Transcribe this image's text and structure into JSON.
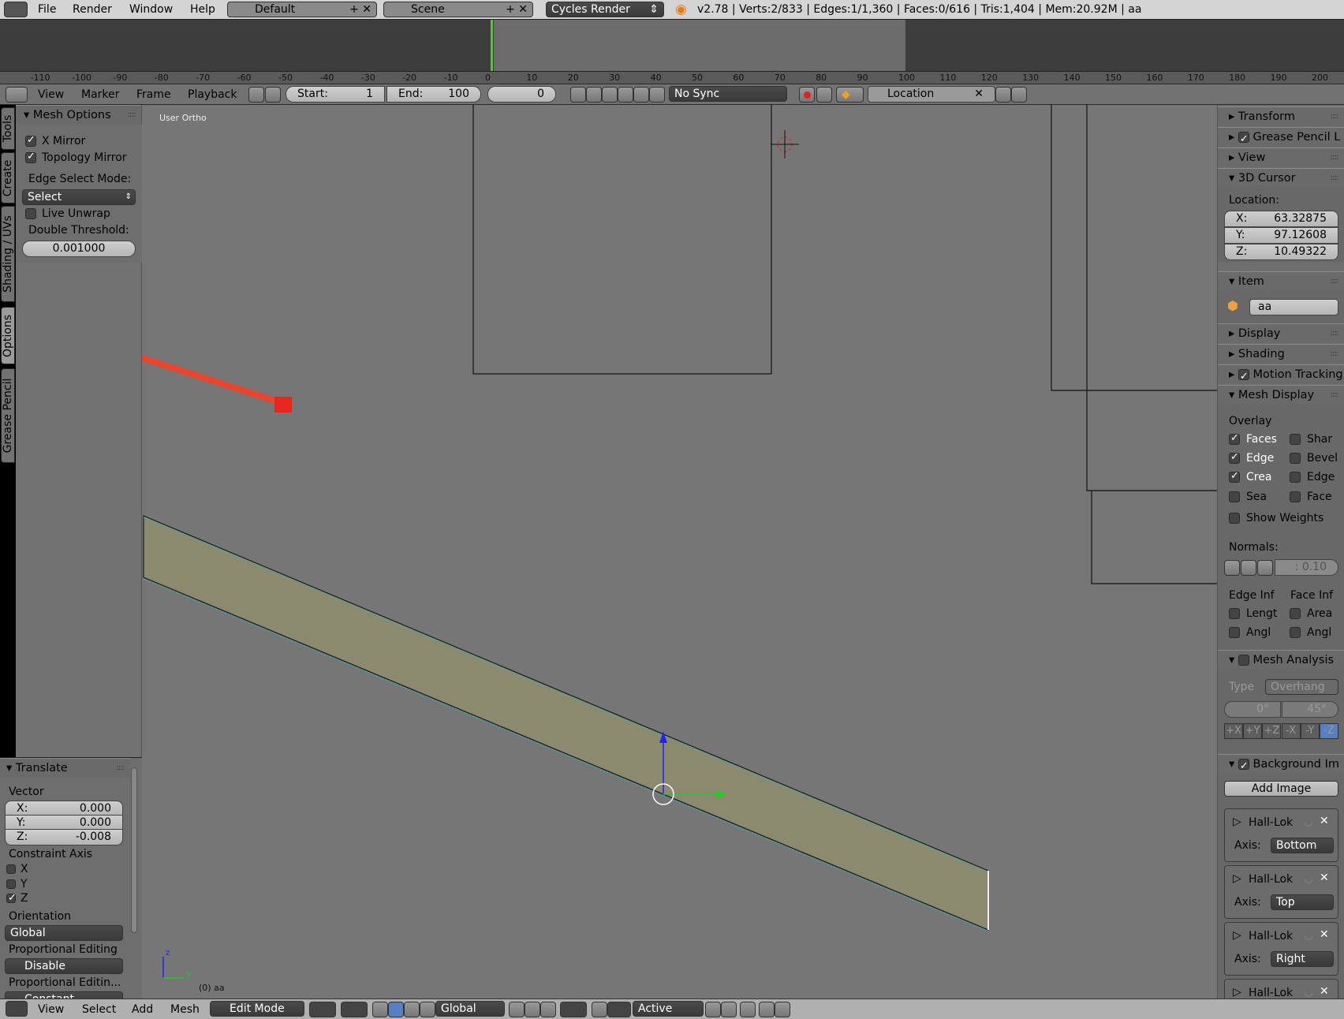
{
  "topbar": {
    "menus": [
      "File",
      "Render",
      "Window",
      "Help"
    ],
    "layout": "Default",
    "scene": "Scene",
    "engine": "Cycles Render",
    "stats": "v2.78 | Verts:2/833 | Edges:1/1,360 | Faces:0/616 | Tris:1,404 | Mem:20.92M | aa"
  },
  "timeline": {
    "ruler_ticks": [
      "-110",
      "-100",
      "-90",
      "-80",
      "-70",
      "-60",
      "-50",
      "-40",
      "-30",
      "-20",
      "-10",
      "0",
      "10",
      "20",
      "30",
      "40",
      "50",
      "60",
      "70",
      "80",
      "90",
      "100",
      "110",
      "120",
      "130",
      "140",
      "150",
      "160",
      "170",
      "180",
      "190",
      "200"
    ],
    "current_frame_marker": 0,
    "range_end": 100
  },
  "timeline_header": {
    "menus": [
      "View",
      "Marker",
      "Frame",
      "Playback"
    ],
    "start_label": "Start:",
    "start": "1",
    "end_label": "End:",
    "end": "100",
    "current": "0",
    "sync": "No Sync",
    "keying_set": "Location"
  },
  "tabs": [
    "Tools",
    "Create",
    "Shading / UVs",
    "Options",
    "Grease Pencil"
  ],
  "active_tab": "Options",
  "mesh_options": {
    "title": "Mesh Options",
    "x_mirror": "X Mirror",
    "x_mirror_checked": true,
    "topology_mirror": "Topology Mirror",
    "topology_mirror_checked": true,
    "edge_select_mode_label": "Edge Select Mode:",
    "edge_select_mode": "Select",
    "live_unwrap": "Live Unwrap",
    "live_unwrap_checked": false,
    "double_threshold_label": "Double Threshold:",
    "double_threshold": "0.001000"
  },
  "translate": {
    "title": "Translate",
    "vector_label": "Vector",
    "x_label": "X:",
    "x": "0.000",
    "y_label": "Y:",
    "y": "0.000",
    "z_label": "Z:",
    "z": "-0.008",
    "constraint_label": "Constraint Axis",
    "cx": "X",
    "cy": "Y",
    "cz": "Z",
    "constraint": {
      "x": false,
      "y": false,
      "z": true
    },
    "orientation_label": "Orientation",
    "orientation": "Global",
    "prop_label": "Proportional Editing",
    "prop": "Disable",
    "prop_falloff_label": "Proportional Editin...",
    "prop_falloff": "Constant"
  },
  "viewport": {
    "view_name": "User Ortho",
    "object_info": "(0) aa",
    "axis_z": "z",
    "axis_y": "y",
    "mesh_face_color": "#8b8a6e",
    "annotation_arrow_color": "#e8452c"
  },
  "right_panel": {
    "transform": "Transform",
    "grease_pencil": "Grease Pencil L",
    "view": "View",
    "cursor": "3D Cursor",
    "location_label": "Location:",
    "cx_label": "X:",
    "cx": "63.32875",
    "cy_label": "Y:",
    "cy": "97.12608",
    "cz_label": "Z:",
    "cz": "10.49322",
    "item": "Item",
    "item_name": "aa",
    "display": "Display",
    "shading": "Shading",
    "motion_tracking": "Motion Tracking",
    "mesh_display": "Mesh Display",
    "overlay": "Overlay",
    "faces": "Faces",
    "shar": "Shar",
    "edge": "Edge",
    "bevel": "Bevel",
    "crea": "Crea",
    "edge2": "Edge",
    "sea": "Sea",
    "face": "Face",
    "show_weights": "Show Weights",
    "normals": "Normals:",
    "normals_size": ": 0.10",
    "edge_inf": "Edge Inf",
    "face_inf": "Face Inf",
    "lengt": "Lengt",
    "area": "Area",
    "angl": "Angl",
    "angl2": "Angl",
    "mesh_analysis": "Mesh Analysis",
    "type_label": "Type",
    "type": "Overhang",
    "min": "0°",
    "max": "45°",
    "axes": [
      "+X",
      "+Y",
      "+Z",
      "-X",
      "-Y",
      "-Z"
    ],
    "active_axis": "-Z",
    "background": "Background Im",
    "add_image": "Add Image",
    "images": [
      {
        "name": "Hall-Lok",
        "axis": "Bottom"
      },
      {
        "name": "Hall-Lok",
        "axis": "Top"
      },
      {
        "name": "Hall-Lok",
        "axis": "Right"
      },
      {
        "name": "Hall-Lok",
        "axis": ""
      }
    ],
    "axis_label": "Axis:"
  },
  "bottombar": {
    "menus": [
      "View",
      "Select",
      "Add",
      "Mesh"
    ],
    "mode": "Edit Mode",
    "orientation": "Global",
    "pivot": "Active"
  }
}
